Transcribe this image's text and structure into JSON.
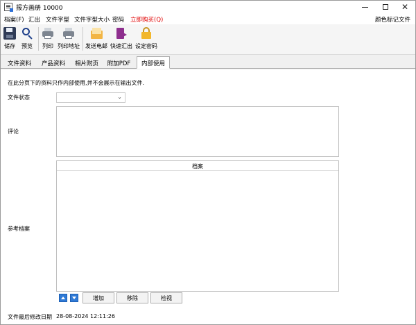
{
  "window": {
    "title": "报方画册 10000",
    "controls": {
      "minimize": "minimize",
      "maximize": "maximize",
      "close": "✕"
    }
  },
  "menu": {
    "items": [
      "档案(F)",
      "汇出",
      "文件字型",
      "文件字型大小",
      "密码",
      "立即购买(Q)"
    ],
    "right_label": "颜色标记文件",
    "accent_color": "#e00000"
  },
  "toolbar": {
    "buttons": [
      {
        "label": "储存",
        "icon": "save-icon"
      },
      {
        "label": "预览",
        "icon": "search-icon"
      },
      {
        "label": "列印",
        "icon": "print-icon"
      },
      {
        "label": "列印地址",
        "icon": "print-address-icon"
      },
      {
        "label": "发送电邮",
        "icon": "mail-icon"
      },
      {
        "label": "快速汇出",
        "icon": "export-icon"
      },
      {
        "label": "设定密码",
        "icon": "lock-icon"
      }
    ]
  },
  "tabs": [
    {
      "label": "文件资料",
      "active": false
    },
    {
      "label": "产品资料",
      "active": false
    },
    {
      "label": "相片附页",
      "active": false
    },
    {
      "label": "附加PDF",
      "active": false
    },
    {
      "label": "内部使用",
      "active": true
    }
  ],
  "panel": {
    "info_text": "在此分页下的资料只作内部使用,并不会展示在输出文件.",
    "status_label": "文件状态",
    "status_value": "",
    "comment_label": "评论",
    "comment_value": "",
    "reference_label": "参考档案",
    "grid_header": "档案",
    "buttons": {
      "add": "增加",
      "remove": "移除",
      "view": "检视"
    },
    "last_modified_label": "文件最后修改日期",
    "last_modified_value": "28-08-2024 12:11:26"
  }
}
